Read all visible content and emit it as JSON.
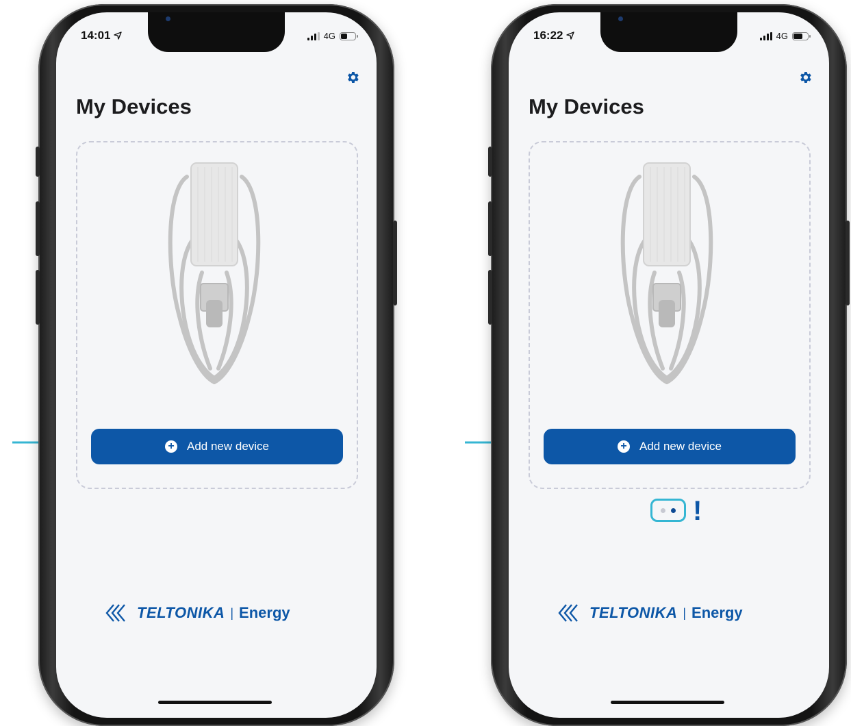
{
  "screens": [
    {
      "status_time": "14:01",
      "network": "4G",
      "title": "My Devices",
      "add_button_label": "Add new device",
      "logo_brand": "TELTONIKA",
      "logo_separator": "|",
      "logo_product": "Energy"
    },
    {
      "status_time": "16:22",
      "network": "4G",
      "title": "My Devices",
      "add_button_label": "Add new device",
      "logo_brand": "TELTONIKA",
      "logo_separator": "|",
      "logo_product": "Energy",
      "pager": {
        "pages": 2,
        "active_page": 2
      },
      "annotation_mark": "!"
    }
  ],
  "colors": {
    "brand_blue": "#0d57a7",
    "annotation_cyan": "#35b6d3",
    "screen_bg": "#f5f6f8"
  },
  "icons": [
    "location-arrow-icon",
    "signal-icon",
    "battery-icon",
    "gear-icon",
    "plus-circle-icon",
    "ev-charger-image",
    "teltonika-logo-icon"
  ]
}
